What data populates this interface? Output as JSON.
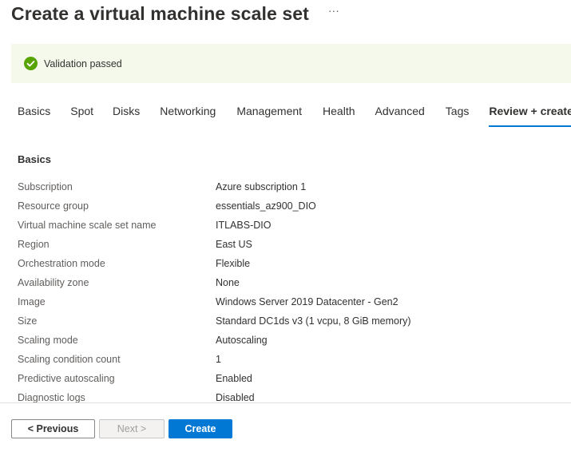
{
  "header": {
    "title": "Create a virtual machine scale set",
    "more_label": "···"
  },
  "validation": {
    "message": "Validation passed",
    "status_color": "#57a300",
    "icon": "check-circle-icon"
  },
  "tabs": [
    {
      "label": "Basics",
      "active": false
    },
    {
      "label": "Spot",
      "active": false
    },
    {
      "label": "Disks",
      "active": false
    },
    {
      "label": "Networking",
      "active": false
    },
    {
      "label": "Management",
      "active": false
    },
    {
      "label": "Health",
      "active": false
    },
    {
      "label": "Advanced",
      "active": false
    },
    {
      "label": "Tags",
      "active": false
    },
    {
      "label": "Review + create",
      "active": true
    }
  ],
  "section": {
    "title": "Basics",
    "rows": [
      {
        "label": "Subscription",
        "value": "Azure subscription 1"
      },
      {
        "label": "Resource group",
        "value": "essentials_az900_DIO"
      },
      {
        "label": "Virtual machine scale set name",
        "value": "ITLABS-DIO"
      },
      {
        "label": "Region",
        "value": "East US"
      },
      {
        "label": "Orchestration mode",
        "value": "Flexible"
      },
      {
        "label": "Availability zone",
        "value": "None"
      },
      {
        "label": "Image",
        "value": "Windows Server 2019 Datacenter - Gen2"
      },
      {
        "label": "Size",
        "value": "Standard DC1ds v3 (1 vcpu, 8 GiB memory)"
      },
      {
        "label": "Scaling mode",
        "value": "Autoscaling"
      },
      {
        "label": "Scaling condition count",
        "value": "1"
      },
      {
        "label": "Predictive autoscaling",
        "value": "Enabled"
      },
      {
        "label": "Diagnostic logs",
        "value": "Disabled"
      }
    ]
  },
  "footer": {
    "previous_label": "< Previous",
    "next_label": "Next >",
    "create_label": "Create",
    "accent_color": "#0078d4"
  }
}
